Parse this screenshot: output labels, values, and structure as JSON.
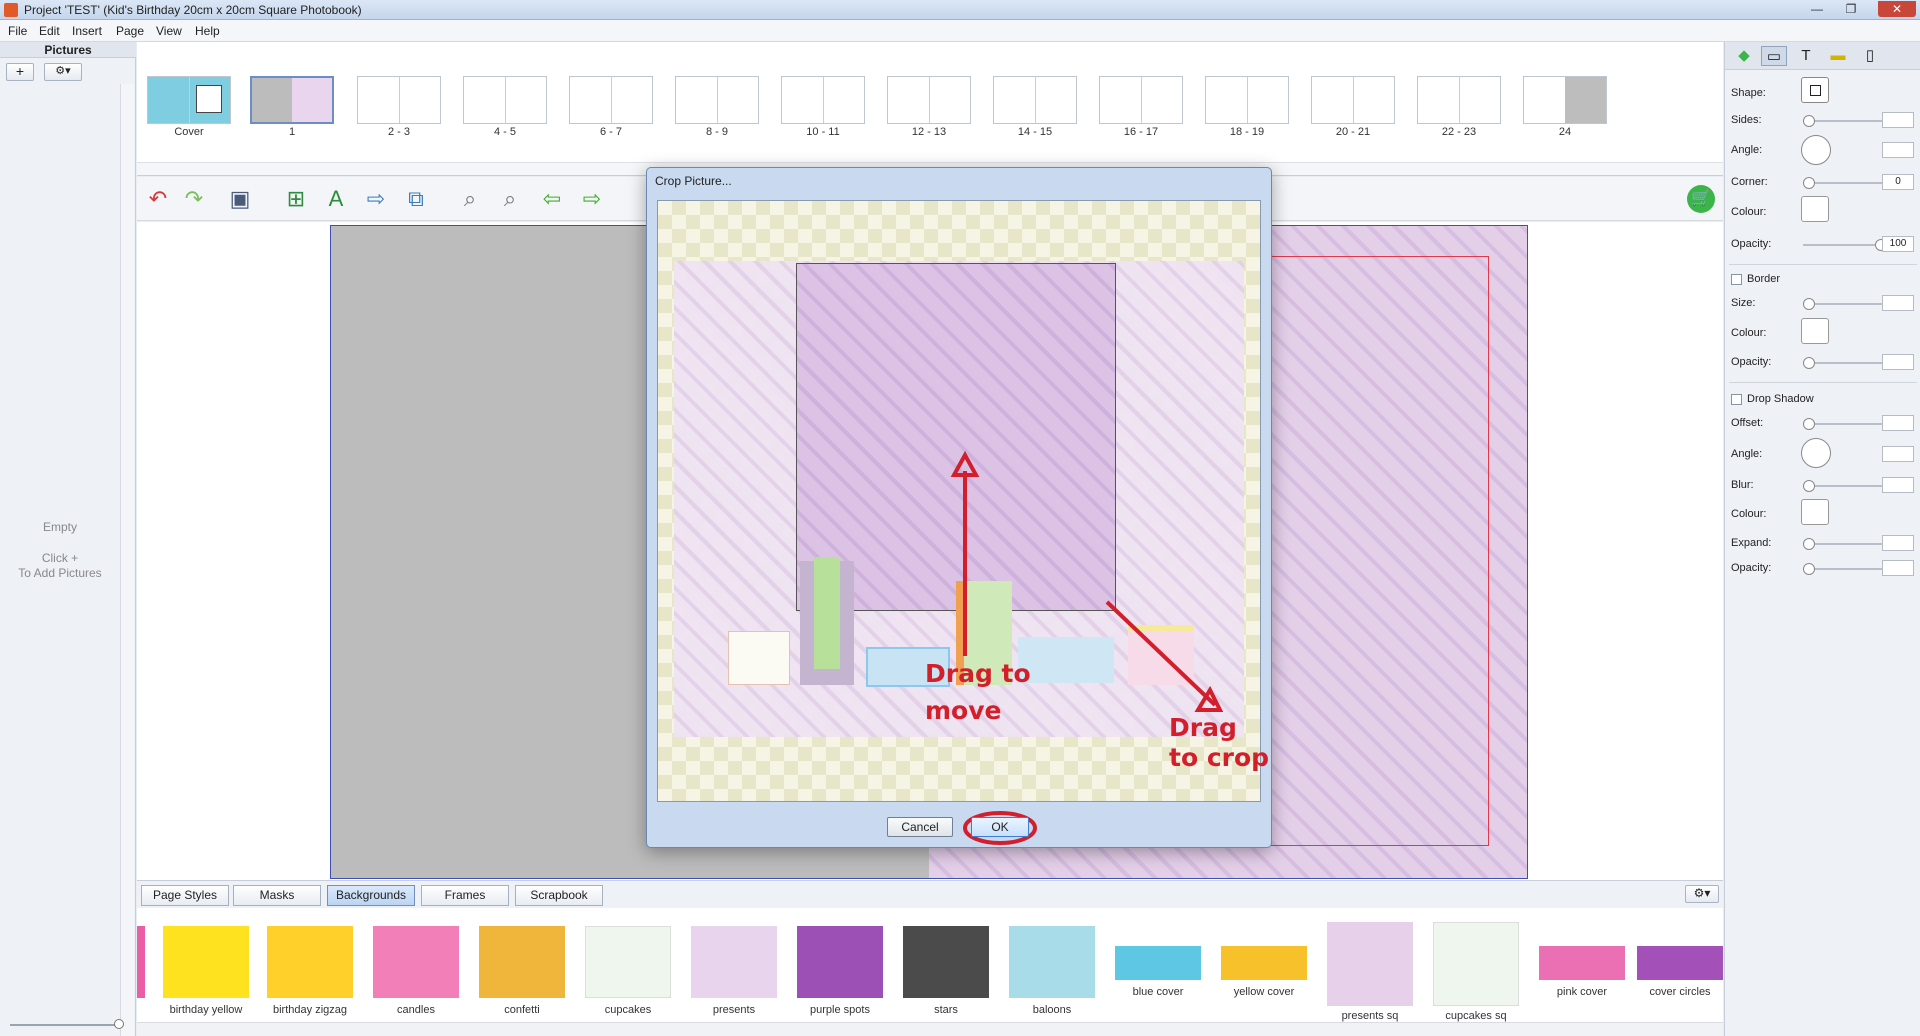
{
  "window": {
    "title": "Project 'TEST' (Kid's Birthday 20cm x 20cm Square Photobook)",
    "min": "—",
    "max": "❐",
    "close": "✕"
  },
  "menu": [
    "File",
    "Edit",
    "Insert",
    "Page",
    "View",
    "Help"
  ],
  "left_panel": {
    "header": "Pictures",
    "add_button": "+",
    "gear_button": "⚙▾",
    "empty_text": "Empty",
    "hint_line1": "Click +",
    "hint_line2": "To Add Pictures"
  },
  "pages": [
    {
      "label": "Cover"
    },
    {
      "label": "1"
    },
    {
      "label": "2 - 3"
    },
    {
      "label": "4 - 5"
    },
    {
      "label": "6 - 7"
    },
    {
      "label": "8 - 9"
    },
    {
      "label": "10 - 11"
    },
    {
      "label": "12 - 13"
    },
    {
      "label": "14 - 15"
    },
    {
      "label": "16 - 17"
    },
    {
      "label": "18 - 19"
    },
    {
      "label": "20 - 21"
    },
    {
      "label": "22 - 23"
    },
    {
      "label": "24"
    }
  ],
  "toolbar_icons": [
    "undo-icon",
    "redo-icon",
    "save-icon",
    "add-picture-icon",
    "add-text-icon",
    "export-icon",
    "duplicate-icon",
    "zoom-out-icon",
    "zoom-in-icon",
    "previous-page-icon",
    "next-page-icon",
    "cart-icon"
  ],
  "background_tabs": [
    {
      "label": "Page Styles",
      "active": false
    },
    {
      "label": "Masks",
      "active": false
    },
    {
      "label": "Backgrounds",
      "active": true
    },
    {
      "label": "Frames",
      "active": false
    },
    {
      "label": "Scrapbook",
      "active": false
    }
  ],
  "backgrounds": [
    {
      "label": "birthday yellow",
      "color": "#ffe21f"
    },
    {
      "label": "birthday zigzag",
      "color": "#ffcf2a"
    },
    {
      "label": "candles",
      "color": "#f27fb8"
    },
    {
      "label": "confetti",
      "color": "#f0b63b"
    },
    {
      "label": "cupcakes",
      "color": "#eef6ee"
    },
    {
      "label": "presents",
      "color": "#e8d4ec"
    },
    {
      "label": "purple spots",
      "color": "#9c4fb5"
    },
    {
      "label": "stars",
      "color": "#4b4b4b"
    },
    {
      "label": "baloons",
      "color": "#a8dce9"
    },
    {
      "label": "blue cover",
      "color": "#5ec7e3"
    },
    {
      "label": "yellow cover",
      "color": "#f6c12b"
    },
    {
      "label": "presents sq",
      "color": "#e6d0ea"
    },
    {
      "label": "cupcakes sq",
      "color": "#eef6ee"
    },
    {
      "label": "pink cover",
      "color": "#ea6fb3"
    },
    {
      "label": "cover circles",
      "color": "#a351b8"
    }
  ],
  "right_panel": {
    "shape_label": "Shape:",
    "sides_label": "Sides:",
    "angle_label": "Angle:",
    "corner_label": "Corner:",
    "corner_value": "0",
    "colour_label": "Colour:",
    "opacity_label": "Opacity:",
    "opacity_value": "100",
    "border_label": "Border",
    "size_label": "Size:",
    "border_colour_label": "Colour:",
    "border_opacity_label": "Opacity:",
    "shadow_label": "Drop Shadow",
    "offset_label": "Offset:",
    "shadow_angle_label": "Angle:",
    "blur_label": "Blur:",
    "shadow_colour_label": "Colour:",
    "expand_label": "Expand:",
    "shadow_opacity_label": "Opacity:"
  },
  "dialog": {
    "title": "Crop Picture...",
    "cancel": "Cancel",
    "ok": "OK"
  },
  "annotations": {
    "move_line1": "Drag to",
    "move_line2": "move",
    "crop": "Drag to crop"
  },
  "colors": {
    "annotation_red": "#d21f2b",
    "page_purple": "#e6d3ec"
  }
}
